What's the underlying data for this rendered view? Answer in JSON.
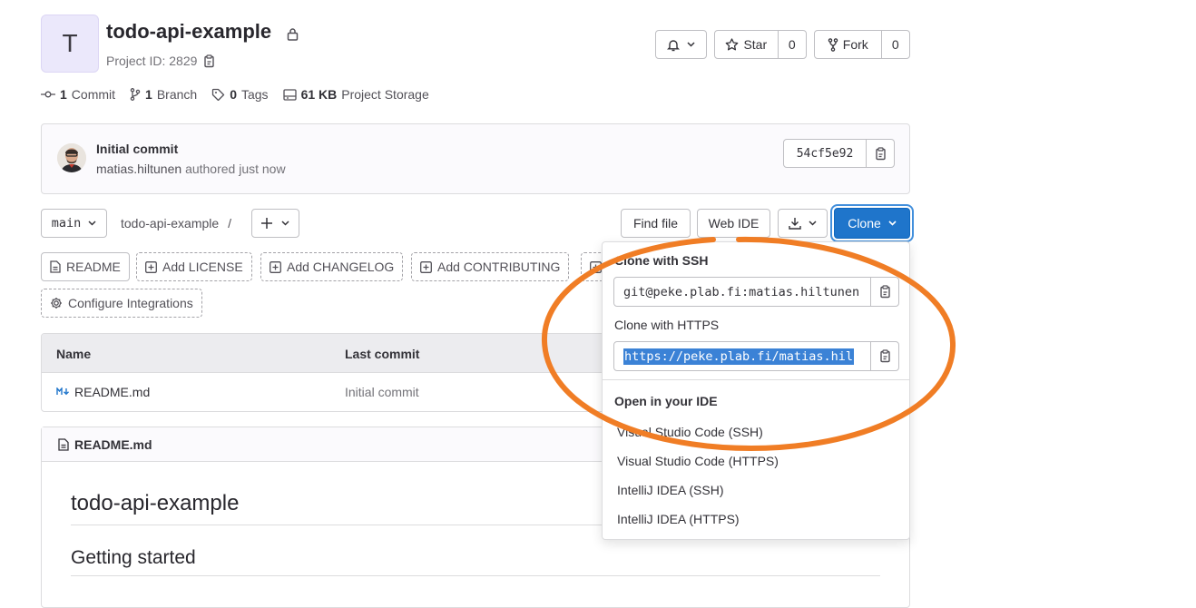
{
  "project": {
    "avatar_letter": "T",
    "name": "todo-api-example",
    "id_label": "Project ID: 2829"
  },
  "actions": {
    "star_label": "Star",
    "star_count": "0",
    "fork_label": "Fork",
    "fork_count": "0"
  },
  "stats": {
    "commits_num": "1",
    "commits_label": "Commit",
    "branches_num": "1",
    "branches_label": "Branch",
    "tags_num": "0",
    "tags_label": "Tags",
    "storage_num": "61 KB",
    "storage_label": "Project Storage"
  },
  "last_commit": {
    "message": "Initial commit",
    "author": "matias.hiltunen",
    "authored_text": "authored just now",
    "sha": "54cf5e92"
  },
  "toolbar": {
    "branch": "main",
    "path": "todo-api-example",
    "separator": "/",
    "find_file": "Find file",
    "web_ide": "Web IDE",
    "clone": "Clone"
  },
  "quick_actions": {
    "readme": "README",
    "license": "Add LICENSE",
    "changelog": "Add CHANGELOG",
    "contributing": "Add CONTRIBUTING",
    "integrations": "Configure Integrations"
  },
  "file_table": {
    "col_name": "Name",
    "col_last_commit": "Last commit",
    "rows": [
      {
        "name": "README.md",
        "last_commit": "Initial commit"
      }
    ]
  },
  "readme": {
    "file_name": "README.md",
    "h1": "todo-api-example",
    "h2": "Getting started"
  },
  "clone_dropdown": {
    "ssh_label": "Clone with SSH",
    "ssh_url": "git@peke.plab.fi:matias.hiltunen",
    "https_label": "Clone with HTTPS",
    "https_url": "https://peke.plab.fi/matias.hil",
    "ide_label": "Open in your IDE",
    "ide_options": [
      "Visual Studio Code (SSH)",
      "Visual Studio Code (HTTPS)",
      "IntelliJ IDEA (SSH)",
      "IntelliJ IDEA (HTTPS)"
    ]
  },
  "colors": {
    "accent": "#1f75cb",
    "annotation": "#f07d25",
    "selection": "#3b82d6"
  }
}
